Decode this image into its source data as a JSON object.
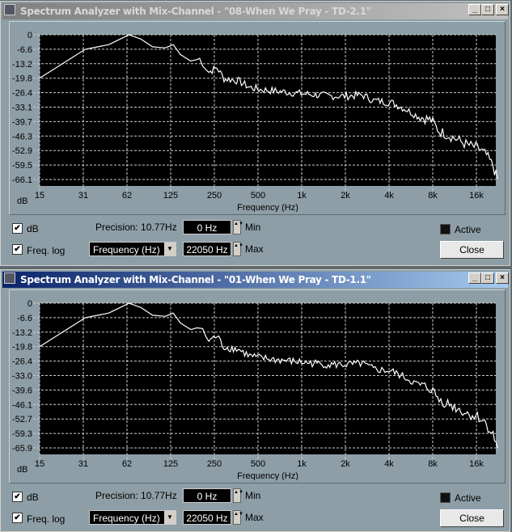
{
  "windows": [
    {
      "title": "Spectrum Analyzer with Mix-Channel - \"08-When We Pray - TD-2.1\"",
      "state": "inactive",
      "y_ticks": [
        "0",
        "-6.6",
        "-13.2",
        "-19.8",
        "-26.4",
        "-33.1",
        "-39.7",
        "-46.3",
        "-52.9",
        "-59.5",
        "-66.1"
      ],
      "db_checked": true,
      "freq_log_checked": true,
      "min_value": "0 Hz",
      "max_value": "22050 Hz",
      "active_checked": false
    },
    {
      "title": "Spectrum Analyzer with Mix-Channel - \"01-When We Pray - TD-1.1\"",
      "state": "active",
      "y_ticks": [
        "0",
        "-6.6",
        "-13.2",
        "-19.8",
        "-26.4",
        "-33.0",
        "-39.6",
        "-46.1",
        "-52.7",
        "-59.3",
        "-65.9"
      ],
      "db_checked": true,
      "freq_log_checked": true,
      "min_value": "0 Hz",
      "max_value": "22050 Hz",
      "active_checked": false
    }
  ],
  "common": {
    "x_ticks": [
      "15",
      "31",
      "62",
      "125",
      "250",
      "500",
      "1k",
      "2k",
      "4k",
      "8k",
      "16k"
    ],
    "x_label": "Frequency (Hz)",
    "y_unit": "dB",
    "db_label": "dB",
    "freq_log_label": "Freq. log",
    "precision": "Precision: 10.77Hz",
    "min_label": "Min",
    "max_label": "Max",
    "axis_select": "Frequency (Hz)",
    "active_label": "Active",
    "close_label": "Close",
    "minimize": "_",
    "maximize": "□",
    "close_glyph": "×"
  },
  "chart_data": {
    "type": "line",
    "xlabel": "Frequency (Hz)",
    "ylabel": "dB",
    "x_scale": "log",
    "xlim": [
      15,
      22050
    ],
    "ylim": [
      -66.1,
      0
    ],
    "series": [
      {
        "name": "spectrum",
        "points": [
          [
            15,
            -19.8
          ],
          [
            31,
            -6.6
          ],
          [
            45,
            -4.5
          ],
          [
            62,
            0
          ],
          [
            75,
            -2
          ],
          [
            90,
            -5.5
          ],
          [
            110,
            -6
          ],
          [
            125,
            -4.5
          ],
          [
            140,
            -9
          ],
          [
            165,
            -12
          ],
          [
            190,
            -11
          ],
          [
            220,
            -17
          ],
          [
            250,
            -15
          ],
          [
            280,
            -20
          ],
          [
            350,
            -21
          ],
          [
            420,
            -24
          ],
          [
            500,
            -25
          ],
          [
            700,
            -26
          ],
          [
            1000,
            -27
          ],
          [
            1500,
            -28
          ],
          [
            2000,
            -28
          ],
          [
            2500,
            -27.5
          ],
          [
            3000,
            -30
          ],
          [
            4000,
            -31
          ],
          [
            5000,
            -34
          ],
          [
            6000,
            -37
          ],
          [
            7500,
            -39
          ],
          [
            8500,
            -44
          ],
          [
            10000,
            -46
          ],
          [
            13000,
            -50
          ],
          [
            16000,
            -52
          ],
          [
            18000,
            -55
          ],
          [
            20000,
            -60
          ],
          [
            21500,
            -66
          ]
        ]
      }
    ]
  }
}
